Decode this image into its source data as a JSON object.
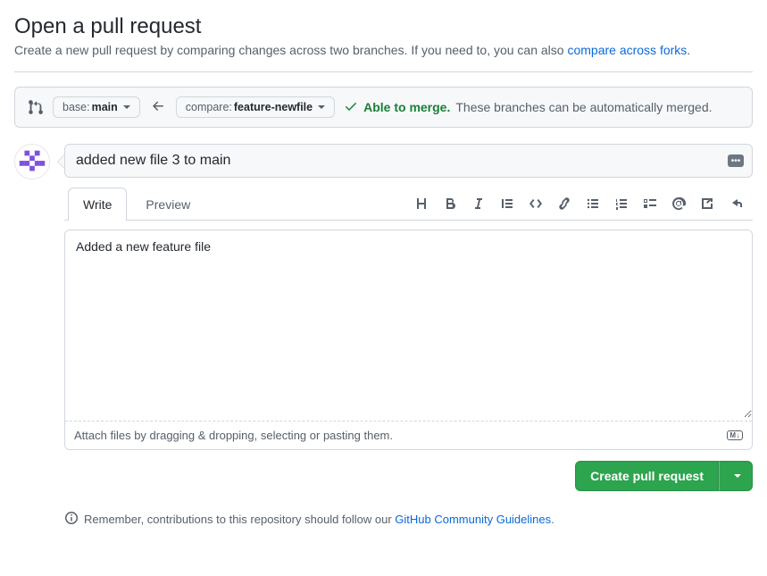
{
  "page": {
    "title": "Open a pull request",
    "subtitle_before": "Create a new pull request by comparing changes across two branches. If you need to, you can also ",
    "subtitle_link": "compare across forks",
    "subtitle_after": "."
  },
  "range": {
    "base_label": "base: ",
    "base_value": "main",
    "compare_label": "compare: ",
    "compare_value": "feature-newfile",
    "merge_ok": "Able to merge.",
    "merge_msg": "These branches can be automatically merged."
  },
  "form": {
    "title_value": "added new file 3 to main",
    "body_value": "Added a new feature file",
    "attach_hint": "Attach files by dragging & dropping, selecting or pasting them.",
    "submit_label": "Create pull request"
  },
  "tabs": {
    "write": "Write",
    "preview": "Preview"
  },
  "footer": {
    "before": "Remember, contributions to this repository should follow our ",
    "link": "GitHub Community Guidelines",
    "after": "."
  }
}
